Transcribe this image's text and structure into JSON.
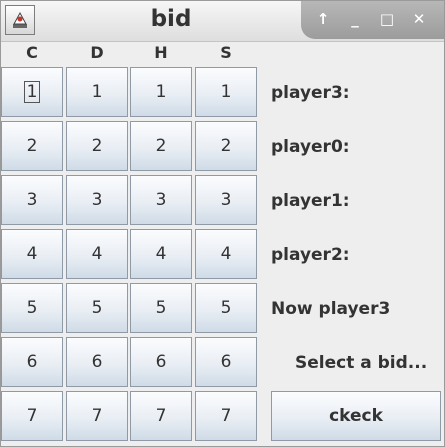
{
  "window": {
    "title": "bid"
  },
  "suits": [
    "C",
    "D",
    "H",
    "S"
  ],
  "bids": [
    "1",
    "2",
    "3",
    "4",
    "5",
    "6",
    "7"
  ],
  "players": [
    "player3:",
    "player0:",
    "player1:",
    "player2:"
  ],
  "status": {
    "current": "Now player3",
    "prompt": "Select a bid..."
  },
  "actions": {
    "check_label": "ckeck"
  },
  "icons": {
    "app": "app-icon",
    "pin": "up-arrow-icon",
    "minimize": "minimize-icon",
    "maximize": "maximize-icon",
    "close": "close-icon"
  }
}
